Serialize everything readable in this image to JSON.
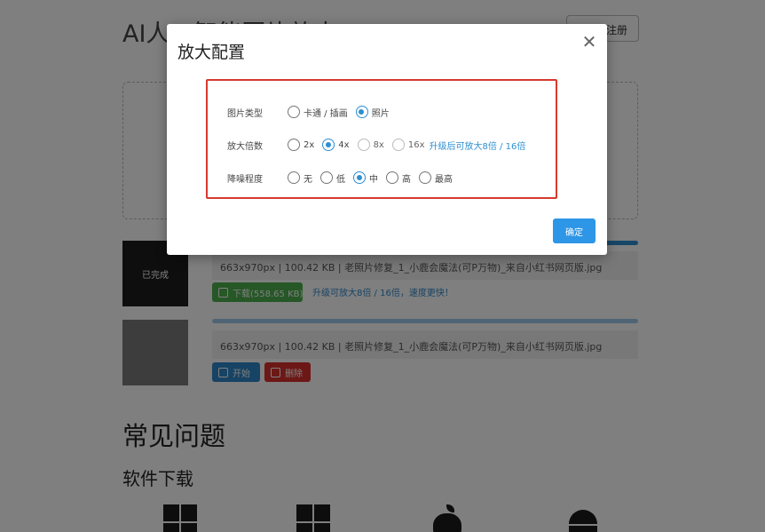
{
  "page": {
    "title": "AI人工智能图片放大",
    "register_label": "注册"
  },
  "files": [
    {
      "status": "已完成",
      "info": "663x970px | 100.42 KB | 老照片修复_1_小鹿会魔法(可P万物)_来自小红书网页版.jpg",
      "progress_percent": 100,
      "download_label": "下载(558.65 KB)",
      "upgrade_link": "升级可放大8倍 / 16倍，速度更快！"
    },
    {
      "info": "663x970px | 100.42 KB | 老照片修复_1_小鹿会魔法(可P万物)_来自小红书网页版.jpg",
      "start_label": "开始",
      "delete_label": "删除"
    }
  ],
  "faq": {
    "title": "常见问题",
    "download_title": "软件下载",
    "platform_icons": [
      "windows-icon",
      "windows-icon",
      "apple-icon",
      "android-icon"
    ]
  },
  "modal": {
    "title": "放大配置",
    "close_icon": "close-icon",
    "confirm_label": "确定",
    "rows": {
      "type": {
        "label": "图片类型",
        "options": [
          "卡通 / 插画",
          "照片"
        ],
        "selected": "照片"
      },
      "scale": {
        "label": "放大倍数",
        "options": [
          "2x",
          "4x",
          "8x",
          "16x"
        ],
        "selected": "4x",
        "upgrade_hint": "升级后可放大8倍 / 16倍"
      },
      "denoise": {
        "label": "降噪程度",
        "options": [
          "无",
          "低",
          "中",
          "高",
          "最高"
        ],
        "selected": "中"
      }
    }
  },
  "colors": {
    "accent": "#2e8fd0",
    "highlight_border": "#d63a2e",
    "download": "#4cae4c",
    "delete": "#d9302c"
  }
}
